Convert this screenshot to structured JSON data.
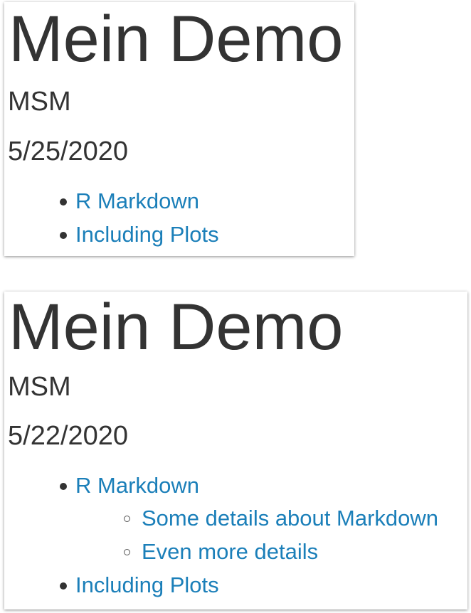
{
  "documents": [
    {
      "title": "Mein Demo",
      "author": "MSM",
      "date": "5/25/2020",
      "toc": [
        {
          "label": "R Markdown"
        },
        {
          "label": "Including Plots"
        }
      ]
    },
    {
      "title": "Mein Demo",
      "author": "MSM",
      "date": "5/22/2020",
      "toc": [
        {
          "label": "R Markdown",
          "children": [
            {
              "label": "Some details about Markdown"
            },
            {
              "label": "Even more details"
            }
          ]
        },
        {
          "label": "Including Plots"
        }
      ]
    }
  ],
  "colors": {
    "text": "#333333",
    "link": "#1b7fb9"
  }
}
